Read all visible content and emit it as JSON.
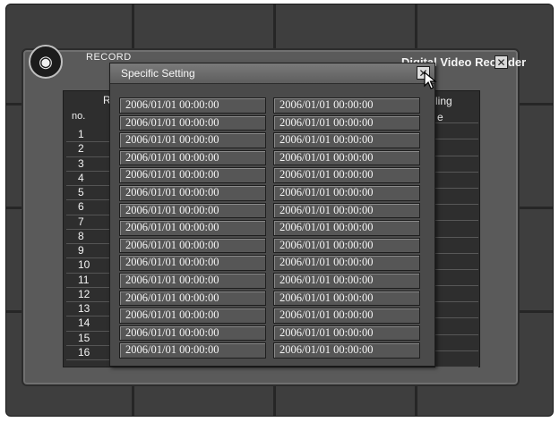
{
  "recorder": {
    "tab_label": "RECORD",
    "title": "Digital Video Recorder",
    "close_glyph": "✕",
    "column_fragment_left": "R",
    "column_fragment_right": "ling",
    "column_fragment_right2": "e",
    "no_header": "no.",
    "rows": [
      "1",
      "2",
      "3",
      "4",
      "5",
      "6",
      "7",
      "8",
      "9",
      "10",
      "11",
      "12",
      "13",
      "14",
      "15",
      "16"
    ]
  },
  "dialog": {
    "title": "Specific Setting",
    "close_glyph": "✕",
    "left_column": [
      "2006/01/01 00:00:00",
      "2006/01/01 00:00:00",
      "2006/01/01 00:00:00",
      "2006/01/01 00:00:00",
      "2006/01/01 00:00:00",
      "2006/01/01 00:00:00",
      "2006/01/01 00:00:00",
      "2006/01/01 00:00:00",
      "2006/01/01 00:00:00",
      "2006/01/01 00:00:00",
      "2006/01/01 00:00:00",
      "2006/01/01 00:00:00",
      "2006/01/01 00:00:00",
      "2006/01/01 00:00:00",
      "2006/01/01 00:00:00"
    ],
    "right_column": [
      "2006/01/01 00:00:00",
      "2006/01/01 00:00:00",
      "2006/01/01 00:00:00",
      "2006/01/01 00:00:00",
      "2006/01/01 00:00:00",
      "2006/01/01 00:00:00",
      "2006/01/01 00:00:00",
      "2006/01/01 00:00:00",
      "2006/01/01 00:00:00",
      "2006/01/01 00:00:00",
      "2006/01/01 00:00:00",
      "2006/01/01 00:00:00",
      "2006/01/01 00:00:00",
      "2006/01/01 00:00:00",
      "2006/01/01 00:00:00"
    ]
  }
}
